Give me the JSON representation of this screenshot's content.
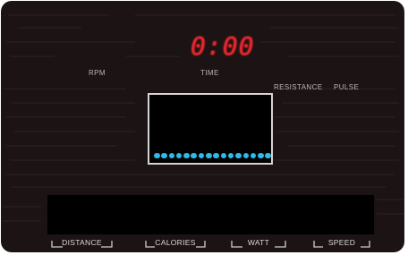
{
  "display": {
    "time_value": "0:00"
  },
  "labels": {
    "rpm": "RPM",
    "time": "TIME",
    "resistance": "RESISTANCE",
    "pulse": "PULSE"
  },
  "buttons": {
    "distance": "DISTANCE",
    "calories": "CALORIES",
    "watt": "WATT",
    "speed": "SPEED"
  },
  "matrix": {
    "dot_count": 16,
    "dot_color": "#2fb9e8"
  },
  "colors": {
    "background": "#1b1314",
    "digit": "#e3262c",
    "label": "#b9b6b6"
  }
}
